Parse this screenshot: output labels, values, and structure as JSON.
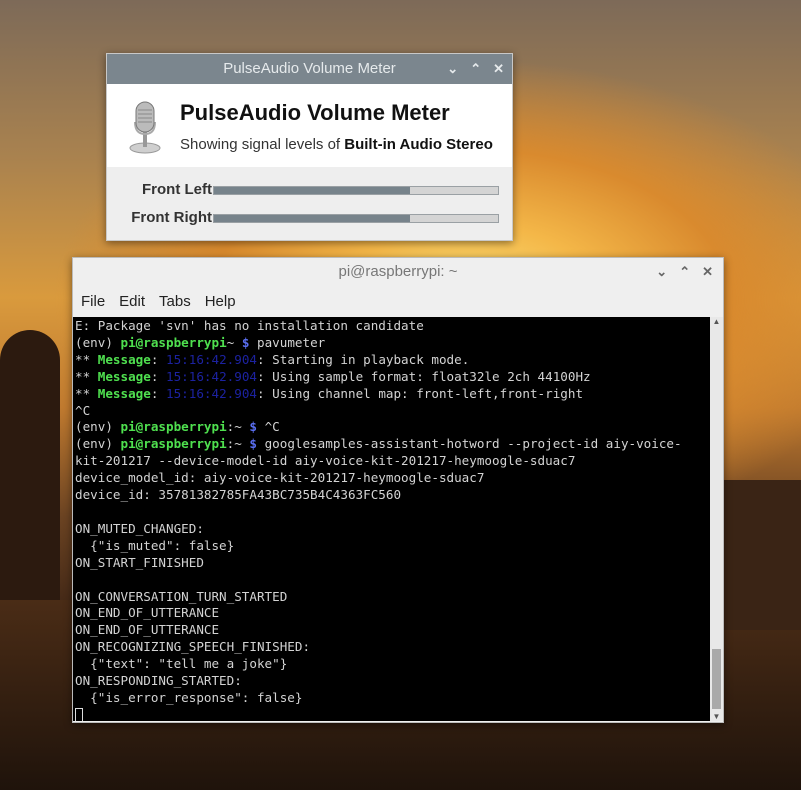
{
  "volume_meter": {
    "window_title": "PulseAudio Volume Meter",
    "heading": "PulseAudio Volume Meter",
    "subtitle_prefix": "Showing signal levels of ",
    "device": "Built-in Audio Stereo",
    "channels": [
      {
        "label": "Front Left",
        "level": 0.69
      },
      {
        "label": "Front Right",
        "level": 0.69
      }
    ],
    "icon": "microphone-icon"
  },
  "terminal": {
    "window_title": "pi@raspberrypi: ~",
    "menu": [
      "File",
      "Edit",
      "Tabs",
      "Help"
    ],
    "lines": [
      [
        [
          "",
          "E: Package 'svn' has no installation candidate"
        ]
      ],
      [
        [
          "",
          "(env) "
        ],
        [
          "g",
          "pi@raspberrypi"
        ],
        [
          "",
          "~"
        ],
        [
          "b",
          " $"
        ],
        [
          "",
          " pavumeter"
        ]
      ],
      [
        [
          "",
          "** "
        ],
        [
          "g",
          "Message"
        ],
        [
          "",
          ": "
        ],
        [
          "d",
          "15:16:42.904"
        ],
        [
          "",
          ": Starting in playback mode."
        ]
      ],
      [
        [
          "",
          "** "
        ],
        [
          "g",
          "Message"
        ],
        [
          "",
          ": "
        ],
        [
          "d",
          "15:16:42.904"
        ],
        [
          "",
          ": Using sample format: float32le 2ch 44100Hz"
        ]
      ],
      [
        [
          "",
          "** "
        ],
        [
          "g",
          "Message"
        ],
        [
          "",
          ": "
        ],
        [
          "d",
          "15:16:42.904"
        ],
        [
          "",
          ": Using channel map: front-left,front-right"
        ]
      ],
      [
        [
          "",
          "^C"
        ]
      ],
      [
        [
          "",
          "(env) "
        ],
        [
          "g",
          "pi@raspberrypi"
        ],
        [
          "",
          ":~"
        ],
        [
          "b",
          " $"
        ],
        [
          "",
          " ^C"
        ]
      ],
      [
        [
          "",
          "(env) "
        ],
        [
          "g",
          "pi@raspberrypi"
        ],
        [
          "",
          ":~"
        ],
        [
          "b",
          " $"
        ],
        [
          "",
          " googlesamples-assistant-hotword --project-id aiy-voice-"
        ]
      ],
      [
        [
          "",
          "kit-201217 --device-model-id aiy-voice-kit-201217-heymoogle-sduac7"
        ]
      ],
      [
        [
          "",
          "device_model_id: aiy-voice-kit-201217-heymoogle-sduac7"
        ]
      ],
      [
        [
          "",
          "device_id: 35781382785FA43BC735B4C4363FC560"
        ]
      ],
      [
        [
          "",
          ""
        ]
      ],
      [
        [
          "",
          "ON_MUTED_CHANGED:"
        ]
      ],
      [
        [
          "",
          "  {\"is_muted\": false}"
        ]
      ],
      [
        [
          "",
          "ON_START_FINISHED"
        ]
      ],
      [
        [
          "",
          ""
        ]
      ],
      [
        [
          "",
          "ON_CONVERSATION_TURN_STARTED"
        ]
      ],
      [
        [
          "",
          "ON_END_OF_UTTERANCE"
        ]
      ],
      [
        [
          "",
          "ON_END_OF_UTTERANCE"
        ]
      ],
      [
        [
          "",
          "ON_RECOGNIZING_SPEECH_FINISHED:"
        ]
      ],
      [
        [
          "",
          "  {\"text\": \"tell me a joke\"}"
        ]
      ],
      [
        [
          "",
          "ON_RESPONDING_STARTED:"
        ]
      ],
      [
        [
          "",
          "  {\"is_error_response\": false}"
        ]
      ]
    ]
  }
}
